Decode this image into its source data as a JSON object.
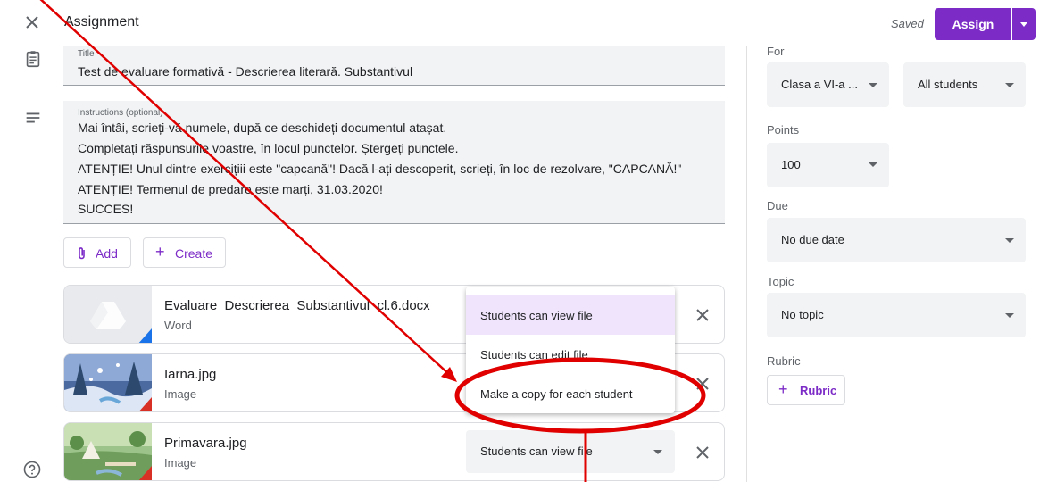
{
  "header": {
    "title": "Assignment",
    "saved_label": "Saved",
    "assign_label": "Assign",
    "accent": "#7c2bc7"
  },
  "form": {
    "title_label": "Title",
    "title_value": "Test de evaluare formativă - Descrierea literară. Substantivul",
    "instructions_label": "Instructions (optional)",
    "instructions_lines": [
      "Mai întâi, scrieți-vă numele, după ce deschideți documentul atașat.",
      "Completați răspunsurile voastre, în locul punctelor. Ștergeți punctele.",
      "ATENȚIE! Unul dintre exercițiii este \"capcană\"! Dacă l-ați descoperit, scrieți, în loc de rezolvare, \"CAPCANĂ!\"",
      "ATENȚIE! Termenul de predare este marți, 31.03.2020!",
      "SUCCES!"
    ],
    "add_label": "Add",
    "create_label": "Create"
  },
  "attachments": [
    {
      "name": "Evaluare_Descrierea_Substantivul_cl.6.docx",
      "type": "Word",
      "icon": "google-drive-icon"
    },
    {
      "name": "Iarna.jpg",
      "type": "Image",
      "icon": "winter-painting-thumbnail"
    },
    {
      "name": "Primavara.jpg",
      "type": "Image",
      "icon": "spring-painting-thumbnail",
      "permission": "Students can view file"
    }
  ],
  "permission_menu": {
    "options": [
      "Students can view file",
      "Students can edit file",
      "Make a copy for each student"
    ],
    "selected": "Students can view file"
  },
  "settings": {
    "for_label": "For",
    "class_value": "Clasa a VI-a ...",
    "students_value": "All students",
    "points_label": "Points",
    "points_value": "100",
    "due_label": "Due",
    "due_value": "No due date",
    "topic_label": "Topic",
    "topic_value": "No topic",
    "rubric_label": "Rubric",
    "rubric_button": "Rubric"
  },
  "annotation_color": "#e00000"
}
